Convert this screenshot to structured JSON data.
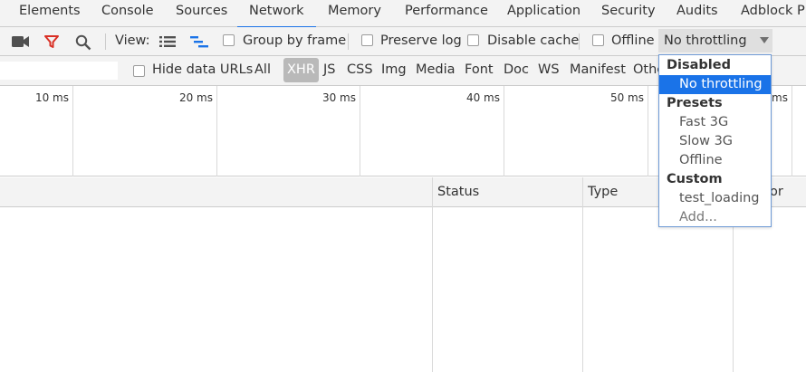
{
  "tabs": [
    {
      "label": "Elements"
    },
    {
      "label": "Console"
    },
    {
      "label": "Sources"
    },
    {
      "label": "Network",
      "active": true
    },
    {
      "label": "Memory"
    },
    {
      "label": "Performance"
    },
    {
      "label": "Application"
    },
    {
      "label": "Security"
    },
    {
      "label": "Audits"
    },
    {
      "label": "Adblock Pl"
    }
  ],
  "toolbar": {
    "record_icon": "video-camera-icon",
    "filter_icon": "filter-icon",
    "search_icon": "search-icon",
    "view_label": "View:",
    "list_view_icon": "list-view-icon",
    "waterfall_view_icon": "waterfall-view-icon",
    "group_by_frame": "Group by frame",
    "preserve_log": "Preserve log",
    "disable_cache": "Disable cache",
    "offline": "Offline",
    "throttling_value": "No throttling",
    "filter_icon_color": "#d93025",
    "view_icon_color": "#1a73e8"
  },
  "filterbar": {
    "hide_data_urls": "Hide data URLs",
    "types": [
      "All",
      "XHR",
      "JS",
      "CSS",
      "Img",
      "Media",
      "Font",
      "Doc",
      "WS",
      "Manifest",
      "Othe"
    ],
    "selected": "XHR"
  },
  "overview": {
    "ticks": [
      "10 ms",
      "20 ms",
      "30 ms",
      "40 ms",
      "50 ms",
      "ms"
    ]
  },
  "table": {
    "columns": [
      "Status",
      "Type",
      "or"
    ]
  },
  "throttling_menu": {
    "group_disabled": "Disabled",
    "no_throttling": "No throttling",
    "group_presets": "Presets",
    "fast_3g": "Fast 3G",
    "slow_3g": "Slow 3G",
    "offline": "Offline",
    "group_custom": "Custom",
    "test_loading": "test_loading",
    "add": "Add...",
    "highlight_color": "#1a73e8"
  }
}
